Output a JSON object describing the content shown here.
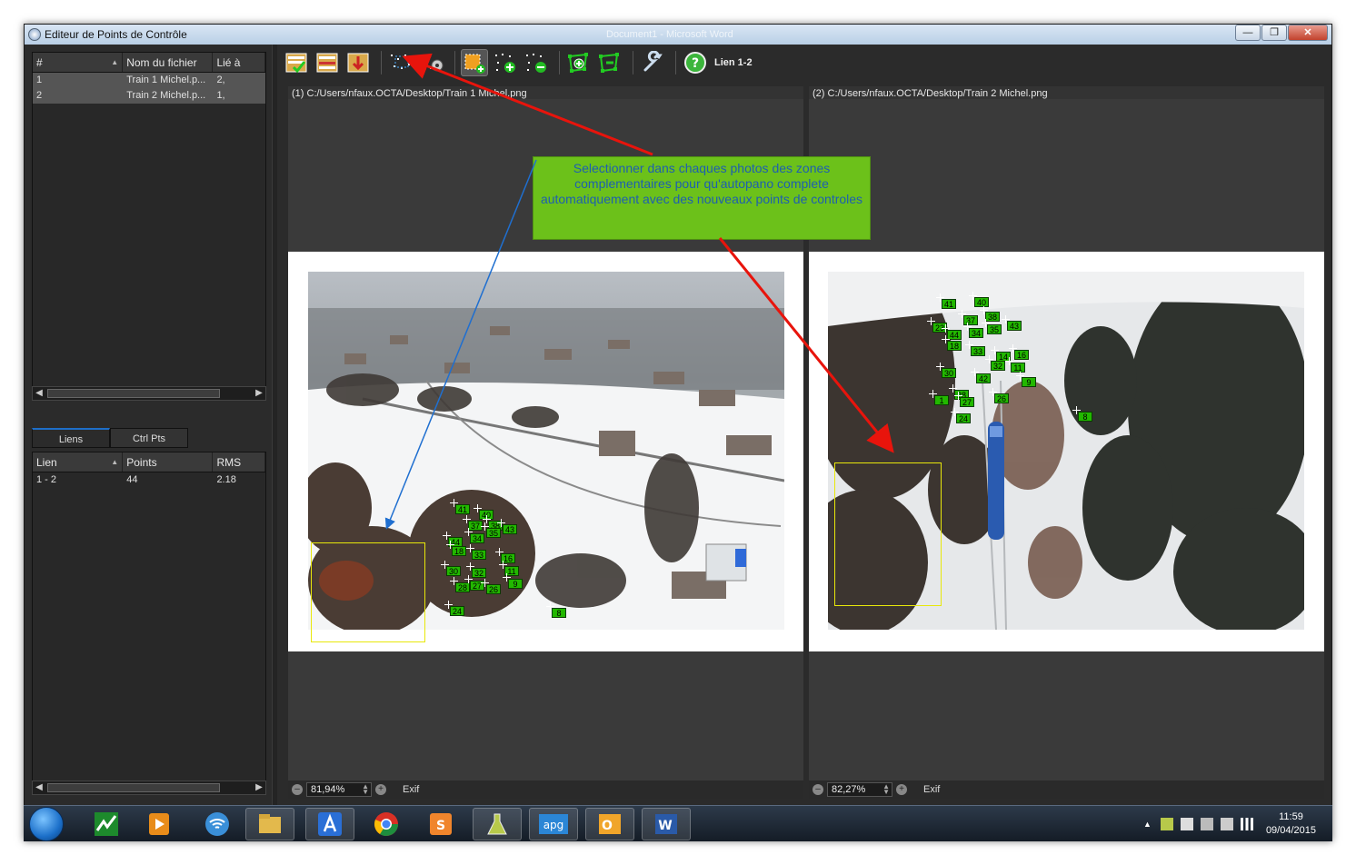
{
  "window": {
    "title": "Editeur de Points de Contrôle",
    "ghost_title": "Document1 - Microsoft Word",
    "buttons": [
      "minimize",
      "maximize",
      "close"
    ]
  },
  "files_table": {
    "columns": [
      "#",
      "Nom du fichier",
      "Lié à"
    ],
    "rows": [
      {
        "num": "1",
        "name": "Train 1 Michel.p...",
        "linked": "2,"
      },
      {
        "num": "2",
        "name": "Train 2 Michel.p...",
        "linked": "1,"
      }
    ]
  },
  "tabs": {
    "links": "Liens",
    "ctrl_pts": "Ctrl Pts"
  },
  "links_table": {
    "columns": [
      "Lien",
      "Points",
      "RMS"
    ],
    "rows": [
      {
        "link": "1 - 2",
        "points": "44",
        "rms": "2.18"
      }
    ]
  },
  "toolbar": {
    "link_label": "Lien 1-2",
    "icons": [
      "validate-icon",
      "remove-link-icon",
      "undo-icon",
      "select-points-icon",
      "auto-points-icon",
      "area-icon",
      "add-points-icon",
      "delete-points-icon",
      "add-cluster-icon",
      "remove-cluster-icon",
      "settings-wrench-icon",
      "help-icon"
    ]
  },
  "panes": {
    "left": {
      "path": "(1) C:/Users/nfaux.OCTA/Desktop/Train 1 Michel.png",
      "zoom": "81,94%",
      "exif": "Exif"
    },
    "right": {
      "path": "(2) C:/Users/nfaux.OCTA/Desktop/Train 2 Michel.png",
      "zoom": "82,27%",
      "exif": "Exif"
    }
  },
  "control_points": {
    "left_labels": [
      "41",
      "40",
      "37",
      "38",
      "44",
      "34",
      "35",
      "43",
      "18",
      "33",
      "16",
      "30",
      "32",
      "11",
      "28",
      "27",
      "26",
      "9",
      "24",
      "8"
    ],
    "right_labels": [
      "41",
      "40",
      "37",
      "38",
      "23",
      "44",
      "34",
      "35",
      "43",
      "18",
      "33",
      "14",
      "16",
      "32",
      "11",
      "30",
      "42",
      "9",
      "28",
      "27",
      "26",
      "24",
      "8",
      "1"
    ]
  },
  "annotation": {
    "text": "Selectionner dans chaques photos des zones complementaires pour qu'autopano complete automatiquement avec des nouveaux points de controles"
  },
  "taskbar": {
    "apps": [
      "Stock chart",
      "Media player",
      "Wifi",
      "Explorer",
      "Autopano",
      "Chrome",
      "Sublime",
      "Lab tool",
      "apg",
      "Outlook",
      "Word"
    ],
    "time": "11:59",
    "date": "09/04/2015"
  }
}
